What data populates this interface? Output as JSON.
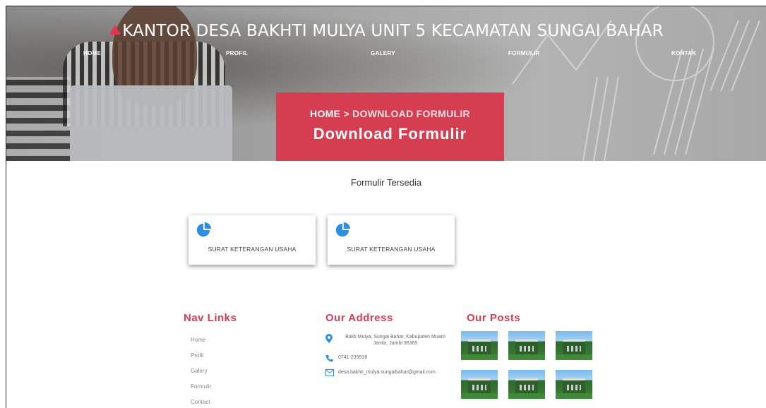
{
  "header": {
    "site_title": "KANTOR DESA BAKHTI MULYA UNIT 5 KECAMATAN SUNGAI BAHAR",
    "logo_icon": "red-triangle-logo-icon",
    "nav": [
      "HOME",
      "PROFIL",
      "GALERY",
      "FORMULIR",
      "KONTAK"
    ]
  },
  "breadcrumb": {
    "home": "HOME",
    "current": "> DOWNLOAD FORMULIR",
    "title": "Download Formulir"
  },
  "main": {
    "section_title": "Formulir Tersedia",
    "cards": [
      {
        "label": "SURAT KETERANGAN USAHA",
        "icon": "pie-chart-icon"
      },
      {
        "label": "SURAT KETERANGAN USAHA",
        "icon": "pie-chart-icon"
      }
    ]
  },
  "footer": {
    "nav_heading": "Nav Links",
    "nav_links": [
      "Home",
      "Profil",
      "Galery",
      "Formulir",
      "Contact"
    ],
    "address_heading": "Our Address",
    "address": "Bakti Mulya, Sungai Bahar, Kabupaten Muaro Jambi, Jambi 36365",
    "phone": "0741-239918",
    "email": "desa.bakhti_mulya.sungaibahar@gmail.com",
    "posts_heading": "Our Posts"
  },
  "colors": {
    "accent": "#d53d51",
    "icon_blue": "#2d8ee3"
  }
}
